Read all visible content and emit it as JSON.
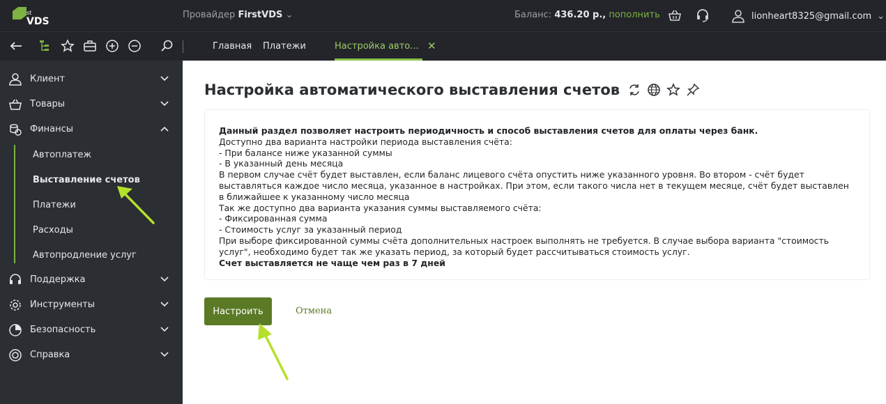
{
  "header": {
    "provider_prefix": "Провайдер",
    "provider_name": "FirstVDS",
    "balance_label": "Баланс:",
    "balance_value": "436.20 р.,",
    "balance_link": "пополнить",
    "user_email": "lionheart8325@gmail.com",
    "logo_small": "st",
    "logo_text": "VDS"
  },
  "tabs": [
    {
      "label": "Главная"
    },
    {
      "label": "Платежи"
    },
    {
      "label": "Настройка авто..."
    }
  ],
  "sidebar": {
    "items": [
      {
        "label": "Клиент",
        "icon": "user-icon"
      },
      {
        "label": "Товары",
        "icon": "basket-icon"
      },
      {
        "label": "Финансы",
        "icon": "coins-icon"
      },
      {
        "label": "Поддержка",
        "icon": "headset-icon"
      },
      {
        "label": "Инструменты",
        "icon": "gear-icon"
      },
      {
        "label": "Безопасность",
        "icon": "pie-icon"
      },
      {
        "label": "Справка",
        "icon": "lifebuoy-icon"
      }
    ],
    "finance_sub": [
      {
        "label": "Автоплатеж"
      },
      {
        "label": "Выставление счетов"
      },
      {
        "label": "Платежи"
      },
      {
        "label": "Расходы"
      },
      {
        "label": "Автопродление услуг"
      }
    ]
  },
  "main": {
    "title": "Настройка автоматического выставления счетов",
    "info_lines": [
      "Данный раздел позволяет настроить периодичность и способ выставления счетов для оплаты через банк.",
      "Доступно два варианта настройки периода выставления счёта:",
      "- При балансе ниже указанной суммы",
      "- В указанный день месяца",
      "В первом случае счёт будет выставлен, если баланс лицевого счёта опустить ниже указанного уровня. Во втором - счёт будет выставляться каждое число месяца, указанное в настройках. При этом, если такого числа нет в текущем месяце, счёт будет выставлен в ближайшее к указанному число месяца",
      "Так же доступно два варианта указания суммы выставляемого счёта:",
      "- Фиксированная сумма",
      "- Стоимость услуг за указанный период",
      "При выборе фиксированной суммы счёта дополнительных настроек выполнять не требуется. В случае выбора варианта \"стоимость услуг\", необходимо будет так же указать период, за который будет рассчитываться стоимость услуг.",
      "Счет выставляется не чаще чем раз в 7 дней"
    ],
    "submit_label": "Настроить",
    "cancel_label": "Отмена"
  },
  "colors": {
    "accent": "#8bc34a",
    "button": "#5b7a26",
    "sidebar_bg": "#2b2e33",
    "topbar_bg": "#23252a"
  }
}
